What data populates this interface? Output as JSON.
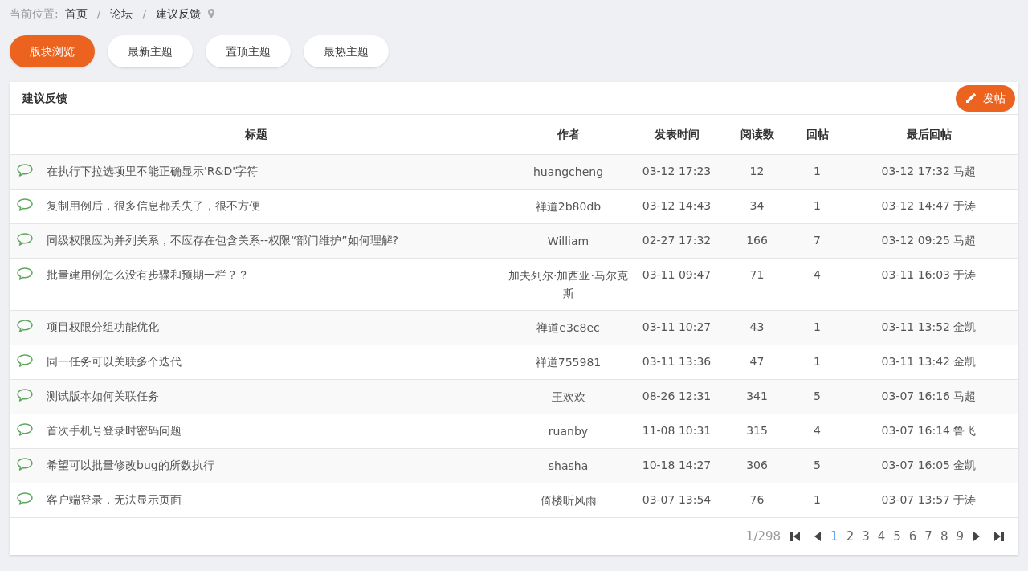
{
  "breadcrumb": {
    "label": "当前位置:",
    "items": [
      "首页",
      "论坛",
      "建议反馈"
    ],
    "separator": "/"
  },
  "tabs": [
    {
      "label": "版块浏览",
      "selected": true
    },
    {
      "label": "最新主题",
      "selected": false
    },
    {
      "label": "置顶主题",
      "selected": false
    },
    {
      "label": "最热主题",
      "selected": false
    }
  ],
  "panel": {
    "title": "建议反馈",
    "post_button": "发帖"
  },
  "table": {
    "columns": [
      "标题",
      "作者",
      "发表时间",
      "阅读数",
      "回帖",
      "最后回帖"
    ],
    "rows": [
      {
        "title": "在执行下拉选项里不能正确显示'R&D'字符",
        "author": "huangcheng",
        "time": "03-12 17:23",
        "reads": "12",
        "replies": "1",
        "last": "03-12 17:32 马超"
      },
      {
        "title": "复制用例后，很多信息都丢失了，很不方便",
        "author": "禅道2b80db",
        "time": "03-12 14:43",
        "reads": "34",
        "replies": "1",
        "last": "03-12 14:47 于涛"
      },
      {
        "title": "同级权限应为并列关系，不应存在包含关系--权限“部门维护”如何理解?",
        "author": "William",
        "time": "02-27 17:32",
        "reads": "166",
        "replies": "7",
        "last": "03-12 09:25 马超"
      },
      {
        "title": "批量建用例怎么没有步骤和预期一栏？？",
        "author": "加夫列尔·加西亚·马尔克斯",
        "time": "03-11 09:47",
        "reads": "71",
        "replies": "4",
        "last": "03-11 16:03 于涛"
      },
      {
        "title": "项目权限分组功能优化",
        "author": "禅道e3c8ec",
        "time": "03-11 10:27",
        "reads": "43",
        "replies": "1",
        "last": "03-11 13:52 金凯"
      },
      {
        "title": "同一任务可以关联多个迭代",
        "author": "禅道755981",
        "time": "03-11 13:36",
        "reads": "47",
        "replies": "1",
        "last": "03-11 13:42 金凯"
      },
      {
        "title": "测试版本如何关联任务",
        "author": "王欢欢",
        "time": "08-26 12:31",
        "reads": "341",
        "replies": "5",
        "last": "03-07 16:16 马超"
      },
      {
        "title": "首次手机号登录时密码问题",
        "author": "ruanby",
        "time": "11-08 10:31",
        "reads": "315",
        "replies": "4",
        "last": "03-07 16:14 鲁飞"
      },
      {
        "title": "希望可以批量修改bug的所数执行",
        "author": "shasha",
        "time": "10-18 14:27",
        "reads": "306",
        "replies": "5",
        "last": "03-07 16:05 金凯"
      },
      {
        "title": "客户端登录，无法显示页面",
        "author": "倚楼听风雨",
        "time": "03-07 13:54",
        "reads": "76",
        "replies": "1",
        "last": "03-07 13:57 于涛"
      }
    ]
  },
  "pagination": {
    "summary": "1/298",
    "pages": [
      {
        "label": "1",
        "selected": true
      },
      {
        "label": "2",
        "selected": false
      },
      {
        "label": "3",
        "selected": false
      },
      {
        "label": "4",
        "selected": false
      },
      {
        "label": "5",
        "selected": false
      },
      {
        "label": "6",
        "selected": false
      },
      {
        "label": "7",
        "selected": false
      },
      {
        "label": "8",
        "selected": false
      },
      {
        "label": "9",
        "selected": false
      }
    ]
  }
}
